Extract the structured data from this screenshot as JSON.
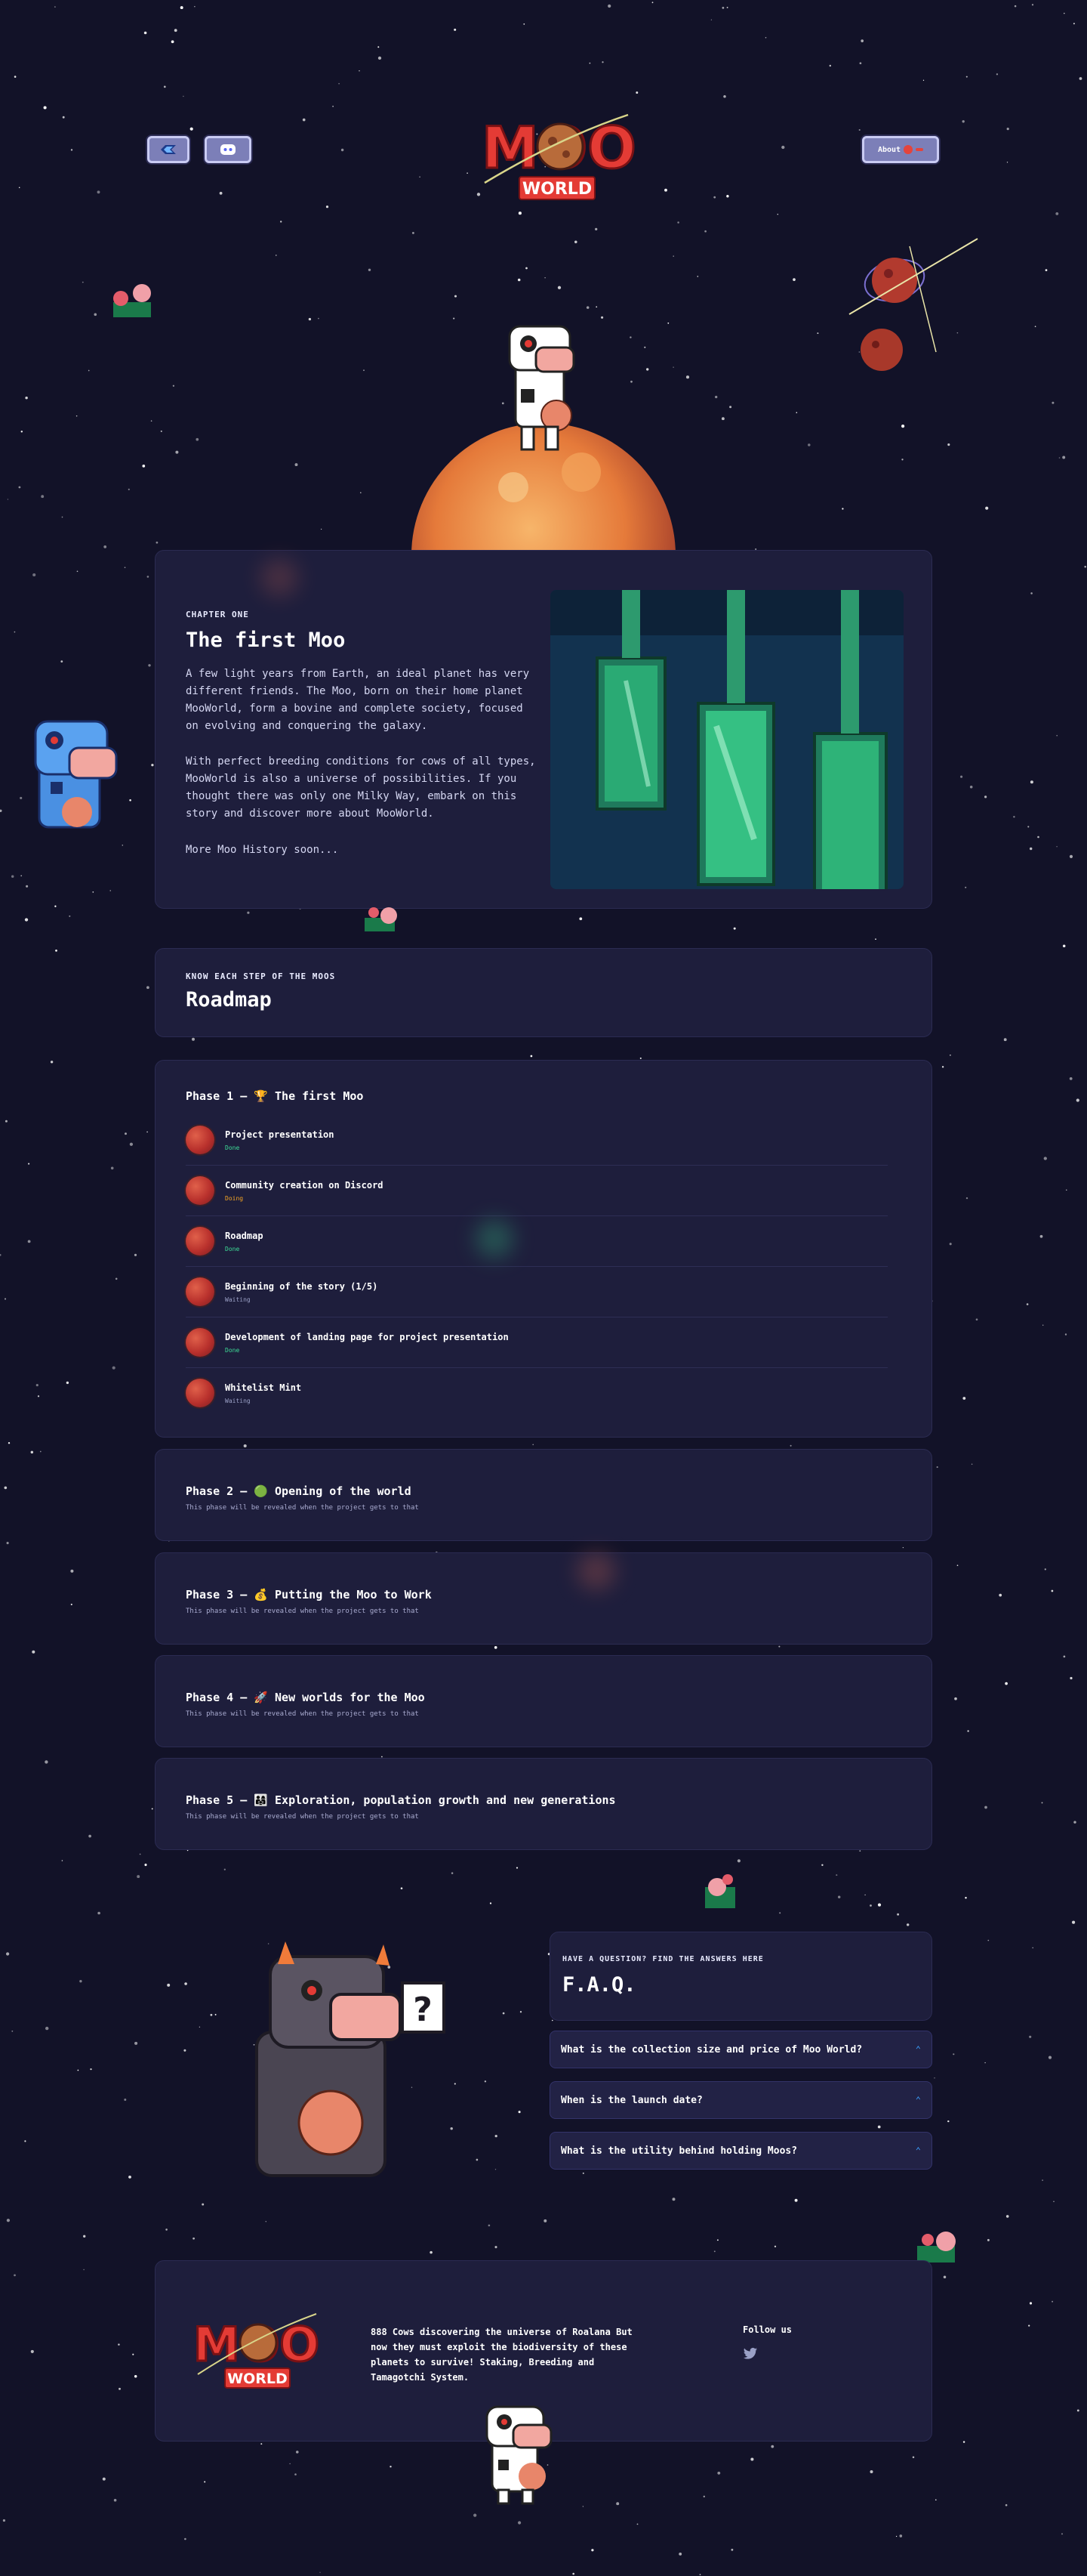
{
  "header": {
    "logo": {
      "word_top": "MOO",
      "word_bottom": "WORLD"
    },
    "left_buttons": [
      {
        "icon": "magic-eden-icon"
      },
      {
        "icon": "discord-icon"
      }
    ],
    "right_button": {
      "label": "About",
      "icon": "planet-icon"
    }
  },
  "chapter": {
    "kicker": "CHAPTER ONE",
    "title": "The first Moo",
    "paragraph1": "A few light years from Earth, an ideal planet has very different friends. The Moo, born on their home planet MooWorld, form a bovine and complete society, focused on evolving and conquering the galaxy.",
    "paragraph2": "With perfect breeding conditions for cows of all types, MooWorld is also a universe of possibilities. If you thought there was only one Milky Way, embark on this story and discover more about MooWorld.",
    "more": "More Moo History soon..."
  },
  "roadmap": {
    "kicker": "KNOW EACH STEP OF THE MOOS",
    "title": "Roadmap",
    "phase1": {
      "title": "Phase 1 – 🏆 The first Moo",
      "items": [
        {
          "name": "Project presentation",
          "status": "Done"
        },
        {
          "name": "Community creation on Discord",
          "status": "Doing"
        },
        {
          "name": "Roadmap",
          "status": "Done"
        },
        {
          "name": "Beginning of the story (1/5)",
          "status": "Waiting"
        },
        {
          "name": "Development of landing page for project presentation",
          "status": "Done"
        },
        {
          "name": "Whitelist Mint",
          "status": "Waiting"
        }
      ]
    },
    "phases": [
      {
        "title": "Phase 2 – 🟢 Opening of the world",
        "subtitle": "This phase will be revealed when the project gets to that"
      },
      {
        "title": "Phase 3 – 💰 Putting the Moo to Work",
        "subtitle": "This phase will be revealed when the project gets to that"
      },
      {
        "title": "Phase 4 – 🚀 New worlds for the Moo",
        "subtitle": "This phase will be revealed when the project gets to that"
      },
      {
        "title": "Phase 5 – 👨‍👩‍👧 Exploration, population growth and new generations",
        "subtitle": "This phase will be revealed when the project gets to that"
      }
    ]
  },
  "faq": {
    "kicker": "HAVE A QUESTION? FIND THE ANSWERS HERE",
    "title": "F.A.Q.",
    "questions": [
      "What is the collection size and price of Moo World?",
      "When is the launch date?",
      "What is the utility behind holding Moos?"
    ]
  },
  "footer": {
    "description": "888 Cows discovering the universe of Roalana But now they must exploit the biodiversity of these planets to survive! Staking, Breeding and Tamagotchi System.",
    "follow_label": "Follow us",
    "social_icon": "twitter-icon"
  },
  "colors": {
    "background": "#121228",
    "panel": "#1e1e3c",
    "done": "#3ddc97",
    "doing": "#f5a524",
    "waiting": "#9aa0c6",
    "accent_blue": "#3aa0ff",
    "logo_red": "#e43b35"
  }
}
